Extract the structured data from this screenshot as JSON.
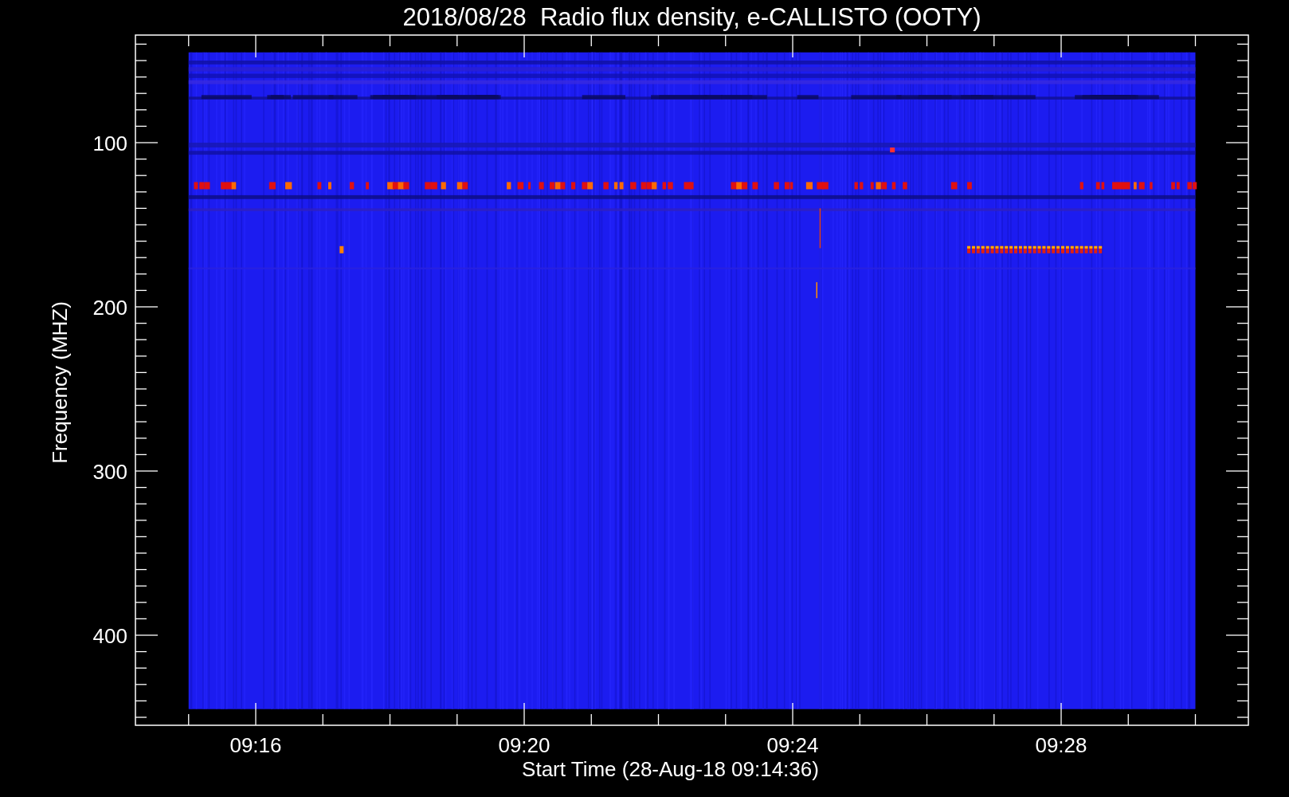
{
  "title": "2018/08/28  Radio flux density, e-CALLISTO (OOTY)",
  "x_axis": {
    "label": "Start Time (28-Aug-18 09:14:36)",
    "ticks": [
      "09:16",
      "09:20",
      "09:24",
      "09:28"
    ]
  },
  "y_axis": {
    "label": "Frequency (MHZ)",
    "ticks": [
      "100",
      "200",
      "300",
      "400"
    ]
  }
}
